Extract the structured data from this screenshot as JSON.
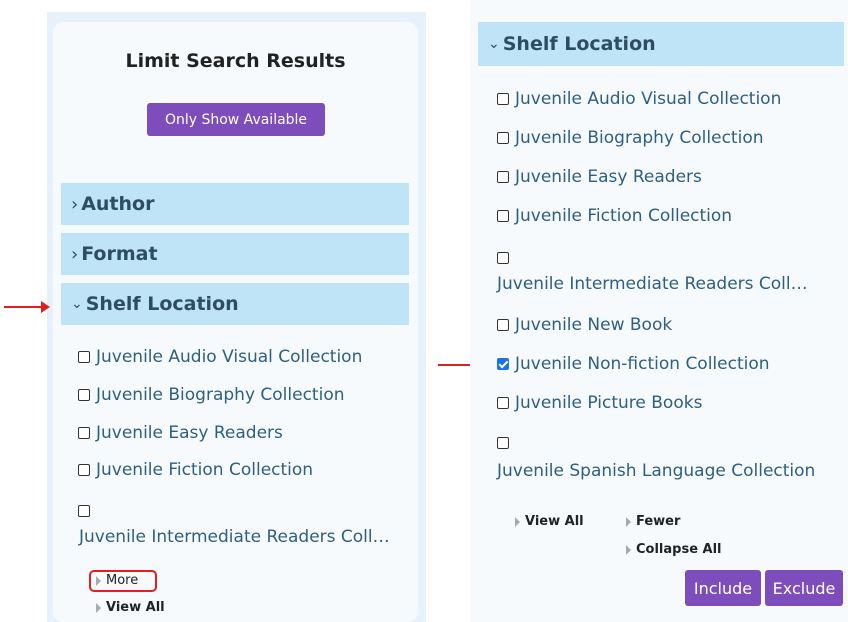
{
  "left": {
    "title": "Limit Search Results",
    "only_available": "Only Show Available",
    "facets": [
      {
        "label": "Author",
        "state": "collapsed"
      },
      {
        "label": "Format",
        "state": "collapsed"
      },
      {
        "label": "Shelf Location",
        "state": "expanded"
      }
    ],
    "options": [
      "Juvenile Audio Visual Collection",
      "Juvenile Biography Collection",
      "Juvenile Easy Readers",
      "Juvenile Fiction Collection",
      "Juvenile Intermediate Readers Coll…"
    ],
    "more_label": "More",
    "view_all_label": "View All"
  },
  "right": {
    "facet_label": "Shelf Location",
    "options": [
      {
        "label": "Juvenile Audio Visual Collection",
        "checked": false
      },
      {
        "label": "Juvenile Biography Collection",
        "checked": false
      },
      {
        "label": "Juvenile Easy Readers",
        "checked": false
      },
      {
        "label": "Juvenile Fiction Collection",
        "checked": false
      },
      {
        "label": "Juvenile Intermediate Readers Coll…",
        "checked": false
      },
      {
        "label": "Juvenile New Book",
        "checked": false
      },
      {
        "label": "Juvenile Non-fiction Collection",
        "checked": true
      },
      {
        "label": "Juvenile Picture Books",
        "checked": false
      },
      {
        "label": "Juvenile Spanish Language Collection",
        "checked": false
      }
    ],
    "view_all_label": "View All",
    "fewer_label": "Fewer",
    "collapse_all_label": "Collapse All",
    "include_label": "Include",
    "exclude_label": "Exclude"
  },
  "colors": {
    "facet_header_bg": "#bfe3f7",
    "button_purple": "#7d4dbb",
    "link_text": "#2f5f80",
    "annotation_arrow": "#e02020"
  }
}
